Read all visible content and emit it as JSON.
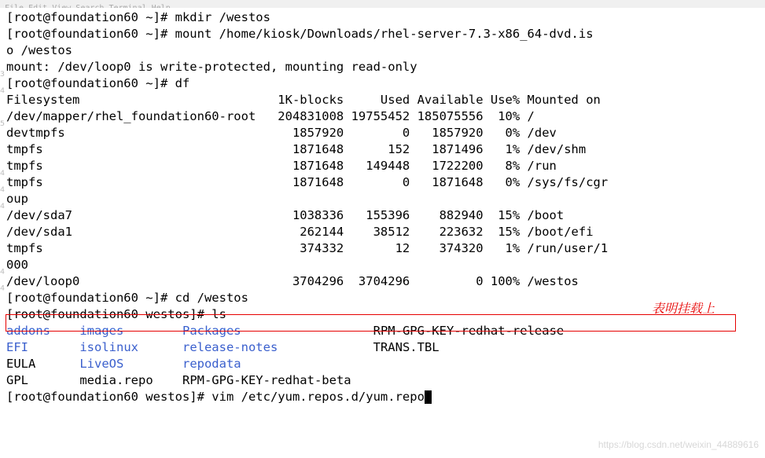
{
  "menubar": "File  Edit  View  Search  Terminal  Help",
  "prompt_root_home": "[root@foundation60 ~]#",
  "prompt_root_westos": "[root@foundation60 westos]#",
  "cmds": {
    "mkdir": "mkdir /westos",
    "mount": "mount /home/kiosk/Downloads/rhel-server-7.3-x86_64-dvd.is",
    "mount_wrap": "o /westos",
    "mount_msg": "mount: /dev/loop0 is write-protected, mounting read-only",
    "df": "df",
    "cd": "cd /westos",
    "ls": "ls",
    "vim": "vim /etc/yum.repos.d/yum.repo"
  },
  "df_header": {
    "fs": "Filesystem",
    "blocks": "1K-blocks",
    "used": "Used",
    "avail": "Available",
    "usep": "Use%",
    "mounted": "Mounted on"
  },
  "df_rows": [
    {
      "fs": "/dev/mapper/rhel_foundation60-root",
      "blocks": "204831008",
      "used": "19755452",
      "avail": "185075556",
      "usep": "10%",
      "mnt": "/"
    },
    {
      "fs": "devtmpfs",
      "blocks": "1857920",
      "used": "0",
      "avail": "1857920",
      "usep": "0%",
      "mnt": "/dev"
    },
    {
      "fs": "tmpfs",
      "blocks": "1871648",
      "used": "152",
      "avail": "1871496",
      "usep": "1%",
      "mnt": "/dev/shm"
    },
    {
      "fs": "tmpfs",
      "blocks": "1871648",
      "used": "149448",
      "avail": "1722200",
      "usep": "8%",
      "mnt": "/run"
    },
    {
      "fs": "tmpfs",
      "blocks": "1871648",
      "used": "0",
      "avail": "1871648",
      "usep": "0%",
      "mnt": "/sys/fs/cgr"
    },
    {
      "wrap": "oup"
    },
    {
      "fs": "/dev/sda7",
      "blocks": "1038336",
      "used": "155396",
      "avail": "882940",
      "usep": "15%",
      "mnt": "/boot"
    },
    {
      "fs": "/dev/sda1",
      "blocks": "262144",
      "used": "38512",
      "avail": "223632",
      "usep": "15%",
      "mnt": "/boot/efi"
    },
    {
      "fs": "tmpfs",
      "blocks": "374332",
      "used": "12",
      "avail": "374320",
      "usep": "1%",
      "mnt": "/run/user/1"
    },
    {
      "wrap": "000"
    },
    {
      "fs": "/dev/loop0",
      "blocks": "3704296",
      "used": "3704296",
      "avail": "0",
      "usep": "100%",
      "mnt": "/westos"
    }
  ],
  "ls_rows": [
    [
      {
        "t": "addons",
        "c": "blue"
      },
      {
        "t": "images",
        "c": "blue"
      },
      {
        "t": "Packages",
        "c": "blue"
      },
      {
        "t": "RPM-GPG-KEY-redhat-release",
        "c": ""
      }
    ],
    [
      {
        "t": "EFI",
        "c": "blue"
      },
      {
        "t": "isolinux",
        "c": "blue"
      },
      {
        "t": "release-notes",
        "c": "blue"
      },
      {
        "t": "TRANS.TBL",
        "c": ""
      }
    ],
    [
      {
        "t": "EULA",
        "c": ""
      },
      {
        "t": "LiveOS",
        "c": "blue"
      },
      {
        "t": "repodata",
        "c": "blue"
      },
      {
        "t": "",
        "c": ""
      }
    ],
    [
      {
        "t": "GPL",
        "c": ""
      },
      {
        "t": "media.repo",
        "c": ""
      },
      {
        "t": "RPM-GPG-KEY-redhat-beta",
        "c": ""
      },
      {
        "t": "",
        "c": ""
      }
    ]
  ],
  "annotation": "表明挂载上",
  "gutter_marks": [
    "3",
    "4",
    "5",
    "4",
    "4",
    "4",
    "4",
    "4"
  ],
  "watermark": "https://blog.csdn.net/weixin_44889616"
}
